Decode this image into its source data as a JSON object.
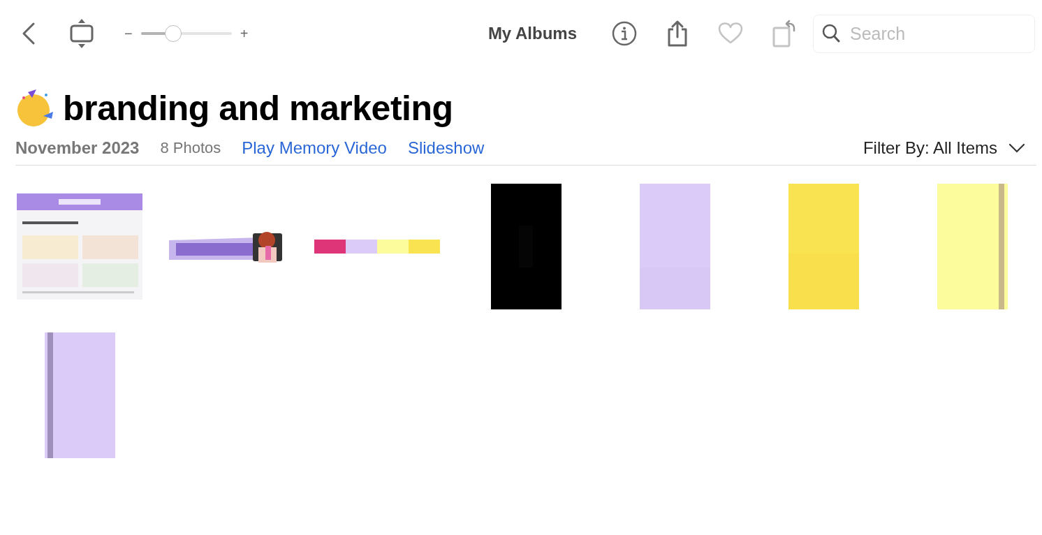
{
  "toolbar": {
    "zoom_minus": "−",
    "zoom_plus": "+",
    "zoom_slider": {
      "level": 0.36
    },
    "title": "My Albums",
    "search": {
      "placeholder": "Search"
    }
  },
  "album": {
    "title": "branding and marketing",
    "date": "November 2023",
    "count": "8 Photos",
    "links": [
      "Play Memory Video",
      "Slideshow"
    ],
    "filter": {
      "label": "Filter By:",
      "value": "All Items"
    }
  }
}
